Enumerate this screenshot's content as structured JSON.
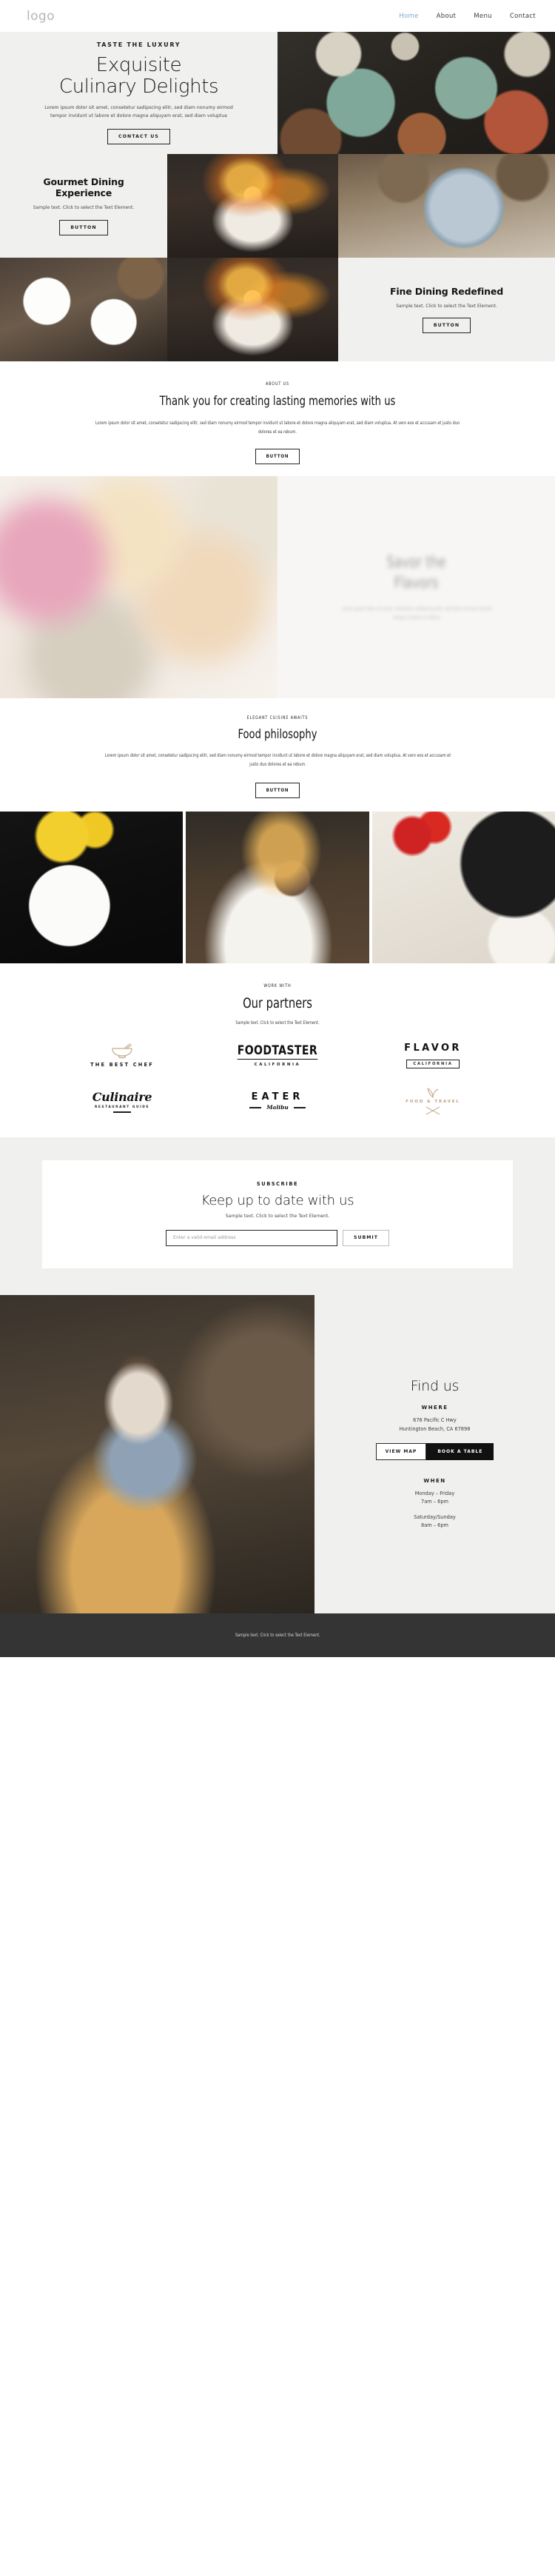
{
  "header": {
    "logo": "logo",
    "nav": [
      {
        "label": "Home",
        "active": true
      },
      {
        "label": "About",
        "active": false
      },
      {
        "label": "Menu",
        "active": false
      },
      {
        "label": "Contact",
        "active": false
      }
    ]
  },
  "hero": {
    "eyebrow": "TASTE THE LUXURY",
    "title_line1": "Exquisite",
    "title_line2": "Culinary Delights",
    "body": "Lorem ipsum dolor sit amet, consetetur sadipscing elitr, sed diam nonumy eirmod tempor invidunt ut labore et dolore magna aliquyam erat, sed diam voluptua",
    "cta": "CONTACT US"
  },
  "feature_cards": {
    "gourmet": {
      "title": "Gourmet Dining Experience",
      "text": "Sample text. Click to select the Text Element.",
      "button": "BUTTON"
    },
    "fine_dining": {
      "title": "Fine Dining Redefined",
      "text": "Sample text. Click to select the Text Element.",
      "button": "BUTTON"
    }
  },
  "about": {
    "eyebrow": "ABOUT US",
    "title": "Thank you for creating lasting memories with us",
    "body": "Lorem ipsum dolor sit amet, consetetur sadipscing elitr, sed diam nonumy eirmod tempor invidunt ut labore et dolore magna aliquyam erat, sed diam voluptua. At vero eos et accusam et justo duo dolores et ea rebum.",
    "button": "BUTTON"
  },
  "savor": {
    "title_line1": "Savor the",
    "title_line2": "Flavors",
    "body": "Lorem ipsum dolor sit amet, consetetur sadipscing elitr, sed diam nonumy eirmod tempor invidunt ut labore"
  },
  "philosophy": {
    "eyebrow": "ELEGANT CUISINE AWAITS",
    "title": "Food philosophy",
    "body": "Lorem ipsum dolor sit amet, consetetur sadipscing elitr, sed diam nonumy eirmod tempor invidunt ut labore et dolore magna aliquyam erat, sed diam voluptua. At vero eos et accusam et justo duo dolores et ea rebum.",
    "button": "BUTTON"
  },
  "partners": {
    "eyebrow": "WORK WITH",
    "title": "Our partners",
    "text": "Sample text. Click to select the Text Element.",
    "logos": [
      {
        "name": "The Best Chef",
        "line1": "THE BEST CHEF",
        "line2": "",
        "icon": "bowl-icon"
      },
      {
        "name": "Foodtaster",
        "line1": "FOODTASTER",
        "line2": "CALIFORNIA",
        "icon": ""
      },
      {
        "name": "Flavor",
        "line1": "FLAVOR",
        "line2": "CALIFORNIA",
        "icon": ""
      },
      {
        "name": "Culinaire",
        "line1": "Culinaire",
        "line2": "RESTAURANT GUIDE",
        "icon": ""
      },
      {
        "name": "Eater Malibu",
        "line1": "EATER",
        "line2": "Malibu",
        "icon": ""
      },
      {
        "name": "Food & Travel",
        "line1": "FOOD & TRAVEL",
        "line2": "",
        "icon": "leaf-icon"
      }
    ]
  },
  "subscribe": {
    "eyebrow": "SUBSCRIBE",
    "title": "Keep up to date with us",
    "text": "Sample text. Click to select the Text Element.",
    "placeholder": "Enter a valid email address",
    "value": "",
    "submit": "SUBMIT"
  },
  "findus": {
    "title": "Find us",
    "where_label": "WHERE",
    "address_line1": "676 Pacific C Hwy",
    "address_line2": "Huntington Beach, CA 67898",
    "view_map": "VIEW MAP",
    "book_table": "BOOK A TABLE",
    "when_label": "WHEN",
    "weekday_days": "Monday – Friday",
    "weekday_hours": "7am – 6pm",
    "weekend_days": "Saturday/Sunday",
    "weekend_hours": "8am – 6pm"
  },
  "footer": {
    "text": "Sample text. Click to select the Text Element."
  },
  "colors": {
    "accent": "#7aa7cd",
    "panel": "#f0f0ef",
    "footer_bg": "#343434",
    "ink": "#141414"
  }
}
